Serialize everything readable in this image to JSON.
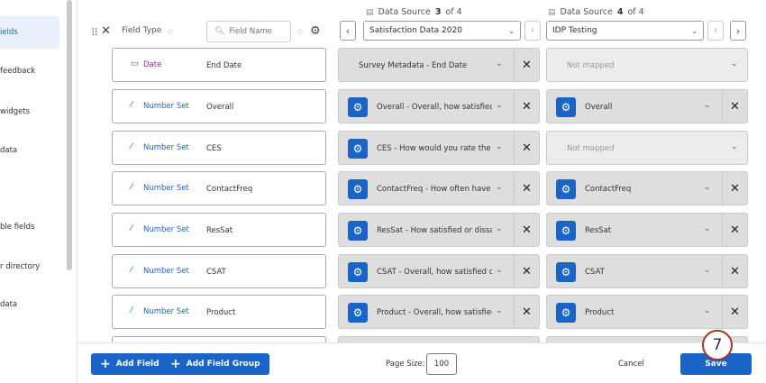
{
  "sidebar": {
    "items": [
      {
        "label": "ields",
        "active": true
      },
      {
        "label": "feedback"
      },
      {
        "label": "widgets"
      },
      {
        "label": "data"
      },
      {
        "label": "ble fields"
      },
      {
        "label": "r directory"
      },
      {
        "label": "data"
      }
    ]
  },
  "header": {
    "field_type_label": "Field Type",
    "search_placeholder": "Field Name",
    "data_source_3": {
      "prefix": "Data Source",
      "index": "3",
      "of": "of 4",
      "selected": "Satisfaction Data 2020"
    },
    "data_source_4": {
      "prefix": "Data Source",
      "index": "4",
      "of": "of 4",
      "selected": "IDP Testing"
    }
  },
  "rows": [
    {
      "type": "Date",
      "field": "End Date",
      "ds3": "Survey Metadata - End Date",
      "ds3_gear": false,
      "ds4": "Not mapped",
      "ds4_mapped": false
    },
    {
      "type": "Number Set",
      "field": "Overall",
      "ds3": "Overall - Overall, how satisfied ...",
      "ds3_gear": true,
      "ds4": "Overall",
      "ds4_mapped": true
    },
    {
      "type": "Number Set",
      "field": "CES",
      "ds3": "CES - How would you rate the ...",
      "ds3_gear": true,
      "ds4": "Not mapped",
      "ds4_mapped": false
    },
    {
      "type": "Number Set",
      "field": "ContactFreq",
      "ds3": "ContactFreq - How often have ...",
      "ds3_gear": true,
      "ds4": "ContactFreq",
      "ds4_mapped": true
    },
    {
      "type": "Number Set",
      "field": "ResSat",
      "ds3": "ResSat - How satisfied or dissa...",
      "ds3_gear": true,
      "ds4": "ResSat",
      "ds4_mapped": true
    },
    {
      "type": "Number Set",
      "field": "CSAT",
      "ds3": "CSAT - Overall, how satisfied o...",
      "ds3_gear": true,
      "ds4": "CSAT",
      "ds4_mapped": true
    },
    {
      "type": "Number Set",
      "field": "Product",
      "ds3": "Product - Overall, how satisfied...",
      "ds3_gear": true,
      "ds4": "Product",
      "ds4_mapped": true
    }
  ],
  "footer": {
    "add_field": "Add Field",
    "add_field_group": "Add Field Group",
    "page_size_label": "Page Size:",
    "page_size_value": "100",
    "cancel": "Cancel",
    "save": "Save"
  },
  "step_badge": "7",
  "colors": {
    "accent": "#1a64c8",
    "date": "#8b2fa6",
    "badge_ring": "#a3352a"
  }
}
